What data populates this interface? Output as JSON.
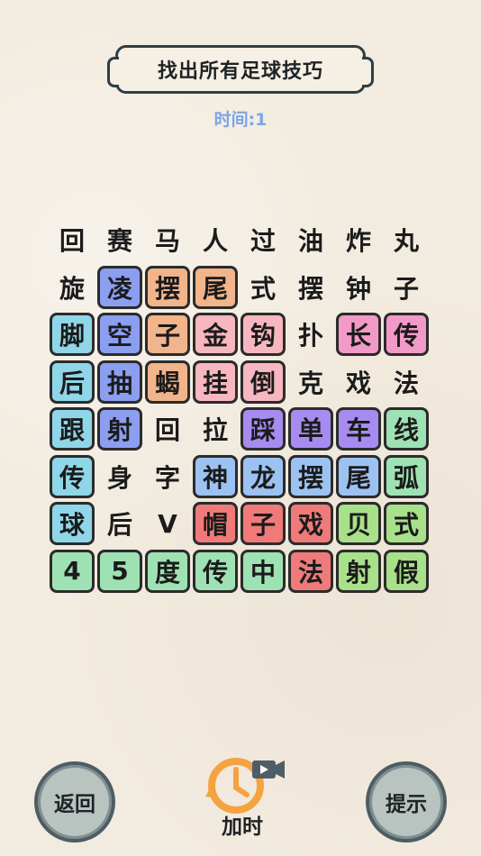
{
  "header": {
    "title": "找出所有足球技巧"
  },
  "status": {
    "timer": "时间:1"
  },
  "grid": {
    "rows": [
      [
        {
          "c": "回",
          "k": "none"
        },
        {
          "c": "赛",
          "k": "none"
        },
        {
          "c": "马",
          "k": "none"
        },
        {
          "c": "人",
          "k": "none"
        },
        {
          "c": "过",
          "k": "none"
        },
        {
          "c": "油",
          "k": "none"
        },
        {
          "c": "炸",
          "k": "none"
        },
        {
          "c": "丸",
          "k": "none"
        }
      ],
      [
        {
          "c": "旋",
          "k": "none"
        },
        {
          "c": "凌",
          "k": "blue"
        },
        {
          "c": "摆",
          "k": "orange"
        },
        {
          "c": "尾",
          "k": "orange"
        },
        {
          "c": "式",
          "k": "none"
        },
        {
          "c": "摆",
          "k": "none"
        },
        {
          "c": "钟",
          "k": "none"
        },
        {
          "c": "子",
          "k": "none"
        }
      ],
      [
        {
          "c": "脚",
          "k": "cyan"
        },
        {
          "c": "空",
          "k": "blue"
        },
        {
          "c": "子",
          "k": "orange"
        },
        {
          "c": "金",
          "k": "pink"
        },
        {
          "c": "钩",
          "k": "pink"
        },
        {
          "c": "扑",
          "k": "none"
        },
        {
          "c": "长",
          "k": "magenta"
        },
        {
          "c": "传",
          "k": "magenta"
        }
      ],
      [
        {
          "c": "后",
          "k": "cyan"
        },
        {
          "c": "抽",
          "k": "blue"
        },
        {
          "c": "蝎",
          "k": "orange"
        },
        {
          "c": "挂",
          "k": "pink"
        },
        {
          "c": "倒",
          "k": "pink"
        },
        {
          "c": "克",
          "k": "none"
        },
        {
          "c": "戏",
          "k": "none"
        },
        {
          "c": "法",
          "k": "none"
        }
      ],
      [
        {
          "c": "跟",
          "k": "cyan"
        },
        {
          "c": "射",
          "k": "blue"
        },
        {
          "c": "回",
          "k": "none"
        },
        {
          "c": "拉",
          "k": "none"
        },
        {
          "c": "踩",
          "k": "purple"
        },
        {
          "c": "单",
          "k": "purple"
        },
        {
          "c": "车",
          "k": "purple"
        },
        {
          "c": "线",
          "k": "mint"
        }
      ],
      [
        {
          "c": "传",
          "k": "cyan"
        },
        {
          "c": "身",
          "k": "none"
        },
        {
          "c": "字",
          "k": "none"
        },
        {
          "c": "神",
          "k": "sky"
        },
        {
          "c": "龙",
          "k": "sky"
        },
        {
          "c": "摆",
          "k": "sky"
        },
        {
          "c": "尾",
          "k": "sky"
        },
        {
          "c": "弧",
          "k": "mint"
        }
      ],
      [
        {
          "c": "球",
          "k": "cyan"
        },
        {
          "c": "后",
          "k": "none"
        },
        {
          "c": "V",
          "k": "none"
        },
        {
          "c": "帽",
          "k": "red"
        },
        {
          "c": "子",
          "k": "red"
        },
        {
          "c": "戏",
          "k": "red"
        },
        {
          "c": "贝",
          "k": "green"
        },
        {
          "c": "式",
          "k": "green"
        }
      ],
      [
        {
          "c": "4",
          "k": "mint"
        },
        {
          "c": "5",
          "k": "mint"
        },
        {
          "c": "度",
          "k": "mint"
        },
        {
          "c": "传",
          "k": "mint"
        },
        {
          "c": "中",
          "k": "mint"
        },
        {
          "c": "法",
          "k": "red"
        },
        {
          "c": "射",
          "k": "green"
        },
        {
          "c": "假",
          "k": "green"
        }
      ]
    ]
  },
  "colors": {
    "blue": "#8c9ef0",
    "orange": "#f2b48a",
    "cyan": "#8fd6e8",
    "pink": "#f7b7c0",
    "magenta": "#f29ac7",
    "purple": "#a78bf0",
    "mint": "#9ee2b4",
    "sky": "#9cc2f2",
    "red": "#f07a7a",
    "green": "#a9e08a"
  },
  "buttons": {
    "back": "返回",
    "add_time": "加时",
    "hint": "提示"
  },
  "icons": {
    "add_time": "clock-video-icon"
  }
}
